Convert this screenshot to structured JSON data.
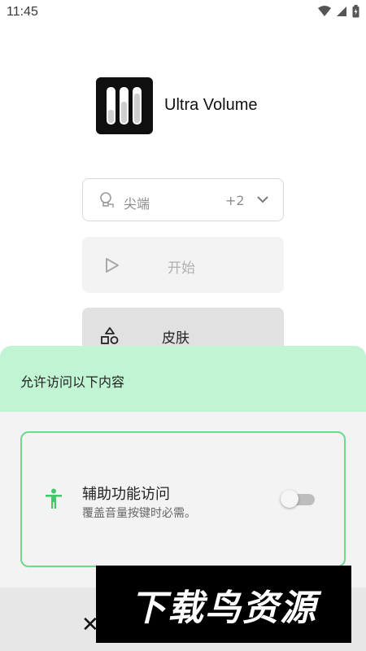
{
  "status_bar": {
    "time": "11:45",
    "icons": [
      "wifi-icon",
      "signal-icon",
      "battery-icon"
    ]
  },
  "app": {
    "name": "Ultra Volume",
    "logo_icon": "slider-logo-icon"
  },
  "selector": {
    "label": "尖端",
    "count": "+2",
    "icon": "bulb-icon"
  },
  "actions": {
    "start_label": "开始",
    "skin_label": "皮肤"
  },
  "sheet": {
    "title": "允许访问以下内容",
    "permission": {
      "title": "辅助功能访问",
      "description": "覆盖音量按键时必需。",
      "enabled": false
    },
    "close_label": "✕"
  },
  "watermark": "下载鸟资源",
  "colors": {
    "sheet_header": "#c1f4d3",
    "accent_green": "#3ec96a",
    "card_border": "#6fd98d"
  }
}
